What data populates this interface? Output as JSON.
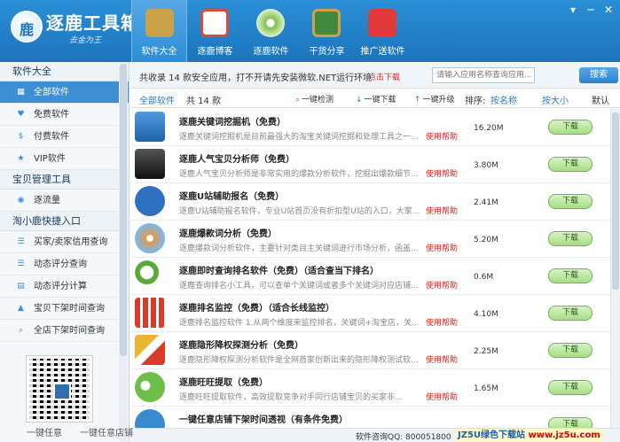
{
  "app": {
    "title": "逐鹿工具箱",
    "subtitle": "去金为王"
  },
  "nav": [
    {
      "label": "软件大全",
      "icon": "box-icon",
      "color": "#c9a24a"
    },
    {
      "label": "逐鹿博客",
      "icon": "blog-icon",
      "color": "#d94b3a"
    },
    {
      "label": "逐鹿软件",
      "icon": "disc-icon",
      "color": "#7bbf4a"
    },
    {
      "label": "干货分享",
      "icon": "board-icon",
      "color": "#3f8a3f"
    },
    {
      "label": "推广送软件",
      "icon": "gift-icon",
      "color": "#e23a3a"
    }
  ],
  "window_controls": [
    "▾",
    "─",
    "✕"
  ],
  "sidebar": {
    "sections": [
      {
        "title": "软件大全",
        "items": [
          {
            "label": "全部软件",
            "icon": "grid-icon",
            "glyph": "▦"
          },
          {
            "label": "免费软件",
            "icon": "heart-icon",
            "glyph": "♥"
          },
          {
            "label": "付费软件",
            "icon": "dollar-icon",
            "glyph": "$"
          },
          {
            "label": "VIP软件",
            "icon": "star-icon",
            "glyph": "★"
          }
        ]
      },
      {
        "title": "宝贝管理工具",
        "items": [
          {
            "label": "逐流量",
            "icon": "flow-icon",
            "glyph": "◉"
          }
        ]
      },
      {
        "title": "淘小鹿快捷入口",
        "items": [
          {
            "label": "买家/卖家信用查询",
            "icon": "list-icon",
            "glyph": "☰"
          },
          {
            "label": "动态评分查询",
            "icon": "list-icon",
            "glyph": "☰"
          },
          {
            "label": "动态评分计算",
            "icon": "calc-icon",
            "glyph": "▤"
          },
          {
            "label": "宝贝下架时间查询",
            "icon": "shirt-icon",
            "glyph": "▲"
          },
          {
            "label": "全店下架时间查询",
            "icon": "search-icon",
            "glyph": "⌕"
          }
        ]
      }
    ]
  },
  "infobar": {
    "text": "共收录 14 款安全应用，打不开请先安装微软.NET运行环境",
    "link": "点击下载",
    "search_placeholder": "请输入应用名称查询应用...",
    "search_button": "搜索"
  },
  "toolbar": {
    "tab": "全部软件",
    "count": "共 14 款",
    "btn_check": "一键检测",
    "btn_download": "一键下载",
    "btn_upgrade": "一键升级",
    "sort_label": "排序:",
    "sort_options": [
      "按名称",
      "按大小",
      "默认"
    ]
  },
  "apps": [
    {
      "title": "逐鹿关键词挖掘机（免费）",
      "desc": "逐鹿关键词挖掘机是目前最强大的淘宝关键词挖掘和处理工具之一...",
      "help": "使用帮助",
      "size": "16.20M",
      "action": "下载",
      "icon": "signpost-icon",
      "color": "#2f7fc8"
    },
    {
      "title": "逐鹿人气宝贝分析师（免费）",
      "desc": "逐鹿人气宝贝分析师是非常实用的爆款分析软件，挖掘出爆款细节...",
      "help": "使用帮助",
      "size": "3.80M",
      "action": "下载",
      "icon": "shield-icon",
      "color": "#2b2b2b"
    },
    {
      "title": "逐鹿U站辅助报名（免费）",
      "desc": "逐鹿U站辅助报名软件，专业U站首页没有折扣型U站的入口，大家...",
      "help": "使用帮助",
      "size": "2.41M",
      "action": "下载",
      "icon": "u-icon",
      "color": "#2e6fc0"
    },
    {
      "title": "逐鹿爆款词分析（免费）",
      "desc": "逐鹿爆款词分析软件，主要针对类目主关键词进行市场分析，函盖...",
      "help": "使用帮助",
      "size": "5.20M",
      "action": "下载",
      "icon": "compass-icon",
      "color": "#e39a4a"
    },
    {
      "title": "逐鹿即时查询排名软件（免费）（适合查当下排名）",
      "desc": "逐鹿查询排名小工具，可以查单个关键词或者多个关键词对应店铺...",
      "help": "使用帮助",
      "size": "0.6M",
      "action": "下载",
      "icon": "magnifier-icon",
      "color": "#5aa83a"
    },
    {
      "title": "逐鹿排名监控（免费）（适合长线监控）",
      "desc": "逐鹿排名监控软件 1.从两个维度来监控排名，关键词+淘宝店，关...",
      "help": "使用帮助",
      "size": "4.10M",
      "action": "下载",
      "icon": "barchart-icon",
      "color": "#d93a2a"
    },
    {
      "title": "逐鹿隐形降权探测分析（免费）",
      "desc": "逐鹿隐形降权探测分析软件是全网首家创新出来的隐形降权测试软...",
      "help": "使用帮助",
      "size": "2.25M",
      "action": "下载",
      "icon": "z-icon",
      "color": "#e8b530"
    },
    {
      "title": "逐鹿旺旺提取（免费）",
      "desc": "逐鹿旺旺提取软件，高效提取竞争对手同行店铺宝贝的买家非...",
      "help": "使用帮助",
      "size": "1.65M",
      "action": "下载",
      "icon": "eyes-icon",
      "color": "#6cc04a"
    },
    {
      "title": "一键任意店铺下架时间透视（有条件免费）",
      "desc": "",
      "help": "",
      "size": "",
      "action": "下载",
      "icon": "clock-icon",
      "color": "#3a8ad0"
    }
  ],
  "statusbar": {
    "text": "软件咨询QQ: 800051800",
    "watermark_blue": "JZ5U绿色下载站",
    "watermark_red": "www.jz5u.com"
  },
  "bottom_overlay": [
    "一键任意",
    "一键任意店铺"
  ]
}
